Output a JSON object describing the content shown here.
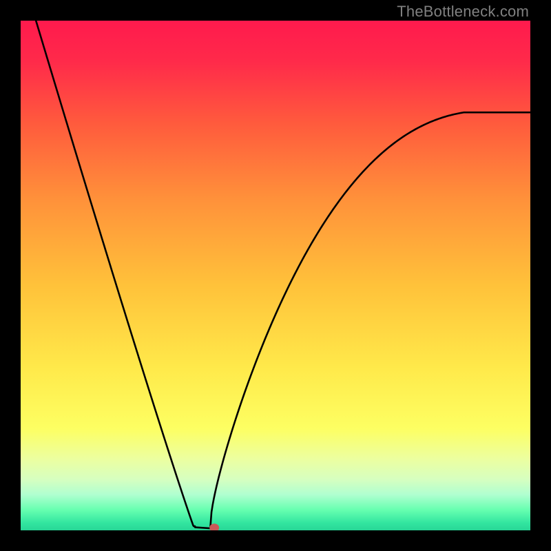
{
  "watermark": "TheBottleneck.com",
  "chart_data": {
    "type": "line",
    "title": "",
    "xlabel": "",
    "ylabel": "",
    "xlim": [
      0,
      1
    ],
    "ylim": [
      0,
      1
    ],
    "curve": {
      "description": "V-shaped bottleneck curve with vertex near x≈0.36 at y≈0; line begins at top-left corner, descends to vertex, then rises with decreasing slope toward the upper right.",
      "vertex_x": 0.36,
      "vertex_y": 0.0,
      "left_start": {
        "x": 0.03,
        "y": 1.0
      },
      "right_end": {
        "x": 1.0,
        "y": 0.82
      }
    },
    "marker": {
      "x": 0.38,
      "y": 0.005,
      "color": "#cc5858"
    },
    "gradient_stops": [
      {
        "offset": 0.0,
        "color": "#ff1a4d"
      },
      {
        "offset": 0.08,
        "color": "#ff2a4a"
      },
      {
        "offset": 0.2,
        "color": "#ff5a3d"
      },
      {
        "offset": 0.35,
        "color": "#ff913a"
      },
      {
        "offset": 0.52,
        "color": "#ffc23a"
      },
      {
        "offset": 0.68,
        "color": "#ffe94a"
      },
      {
        "offset": 0.8,
        "color": "#fdff62"
      },
      {
        "offset": 0.86,
        "color": "#ecffa0"
      },
      {
        "offset": 0.9,
        "color": "#d6ffc0"
      },
      {
        "offset": 0.93,
        "color": "#b0ffd0"
      },
      {
        "offset": 0.96,
        "color": "#66ffb0"
      },
      {
        "offset": 0.985,
        "color": "#33e6a0"
      },
      {
        "offset": 1.0,
        "color": "#28d696"
      }
    ]
  }
}
